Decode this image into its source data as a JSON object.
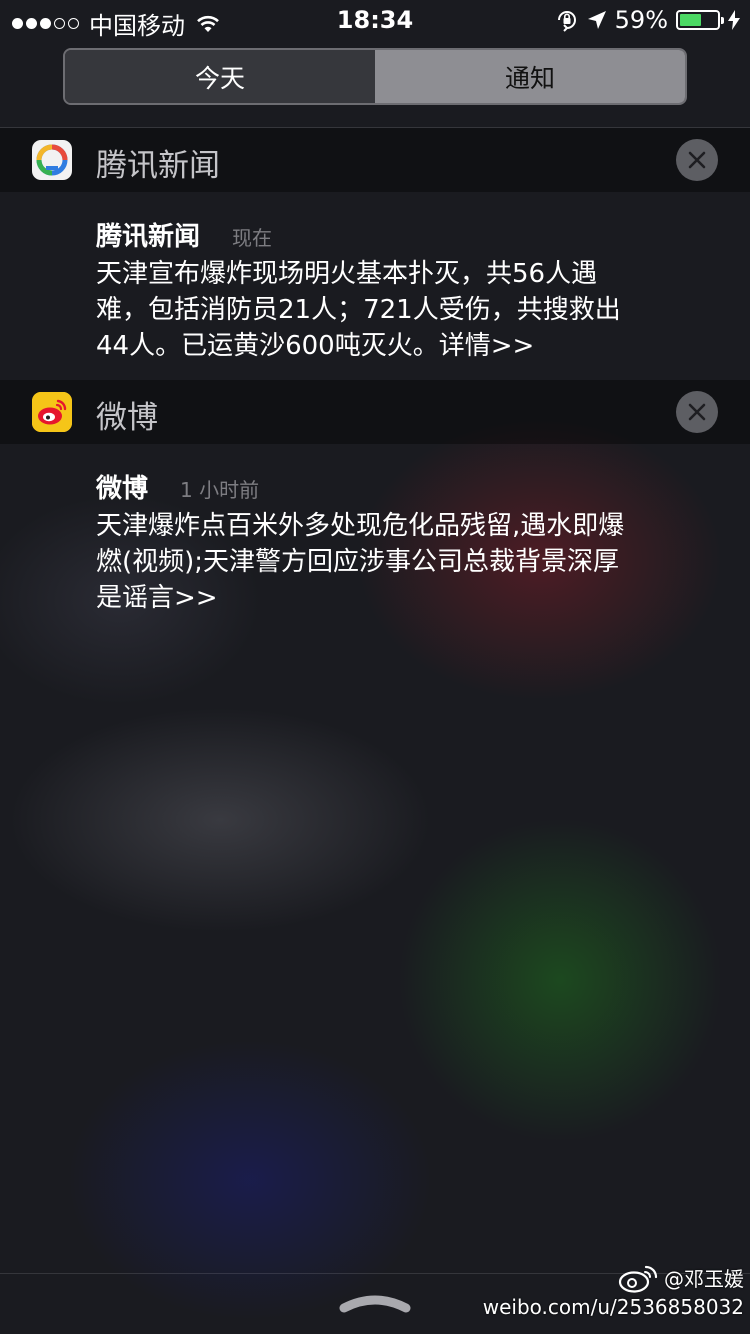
{
  "status_bar": {
    "carrier": "中国移动",
    "time": "18:34",
    "battery_percent": "59%",
    "battery_level": 0.59,
    "icons": [
      "signal-dots-icon",
      "wifi-icon",
      "orientation-lock-icon",
      "location-arrow-icon",
      "battery-icon",
      "charging-bolt-icon"
    ]
  },
  "segmented_control": {
    "today": "今天",
    "notifications": "通知",
    "selected": "今天"
  },
  "groups": [
    {
      "app_name": "腾讯新闻",
      "icon": "tencent-news-icon",
      "notification": {
        "app": "腾讯新闻",
        "time": "现在",
        "lines": [
          "天津宣布爆炸现场明火基本扑灭，共56人遇",
          "难，包括消防员21人；721人受伤，共搜救出",
          "44人。已运黄沙600吨灭火。详情>>"
        ]
      }
    },
    {
      "app_name": "微博",
      "icon": "weibo-icon",
      "notification": {
        "app": "微博",
        "time": "1 小时前",
        "lines": [
          "天津爆炸点百米外多处现危化品残留,遇水即爆",
          "燃(视频);天津警方回应涉事公司总裁背景深厚",
          "是谣言>>"
        ]
      }
    }
  ],
  "watermark": {
    "user": "@邓玉媛",
    "url": "weibo.com/u/2536858032"
  },
  "colors": {
    "battery_green": "#4cd964",
    "close_button": "#5d5e63",
    "segment_inactive": "#8e8e93",
    "weibo_yellow": "#f5c518"
  }
}
